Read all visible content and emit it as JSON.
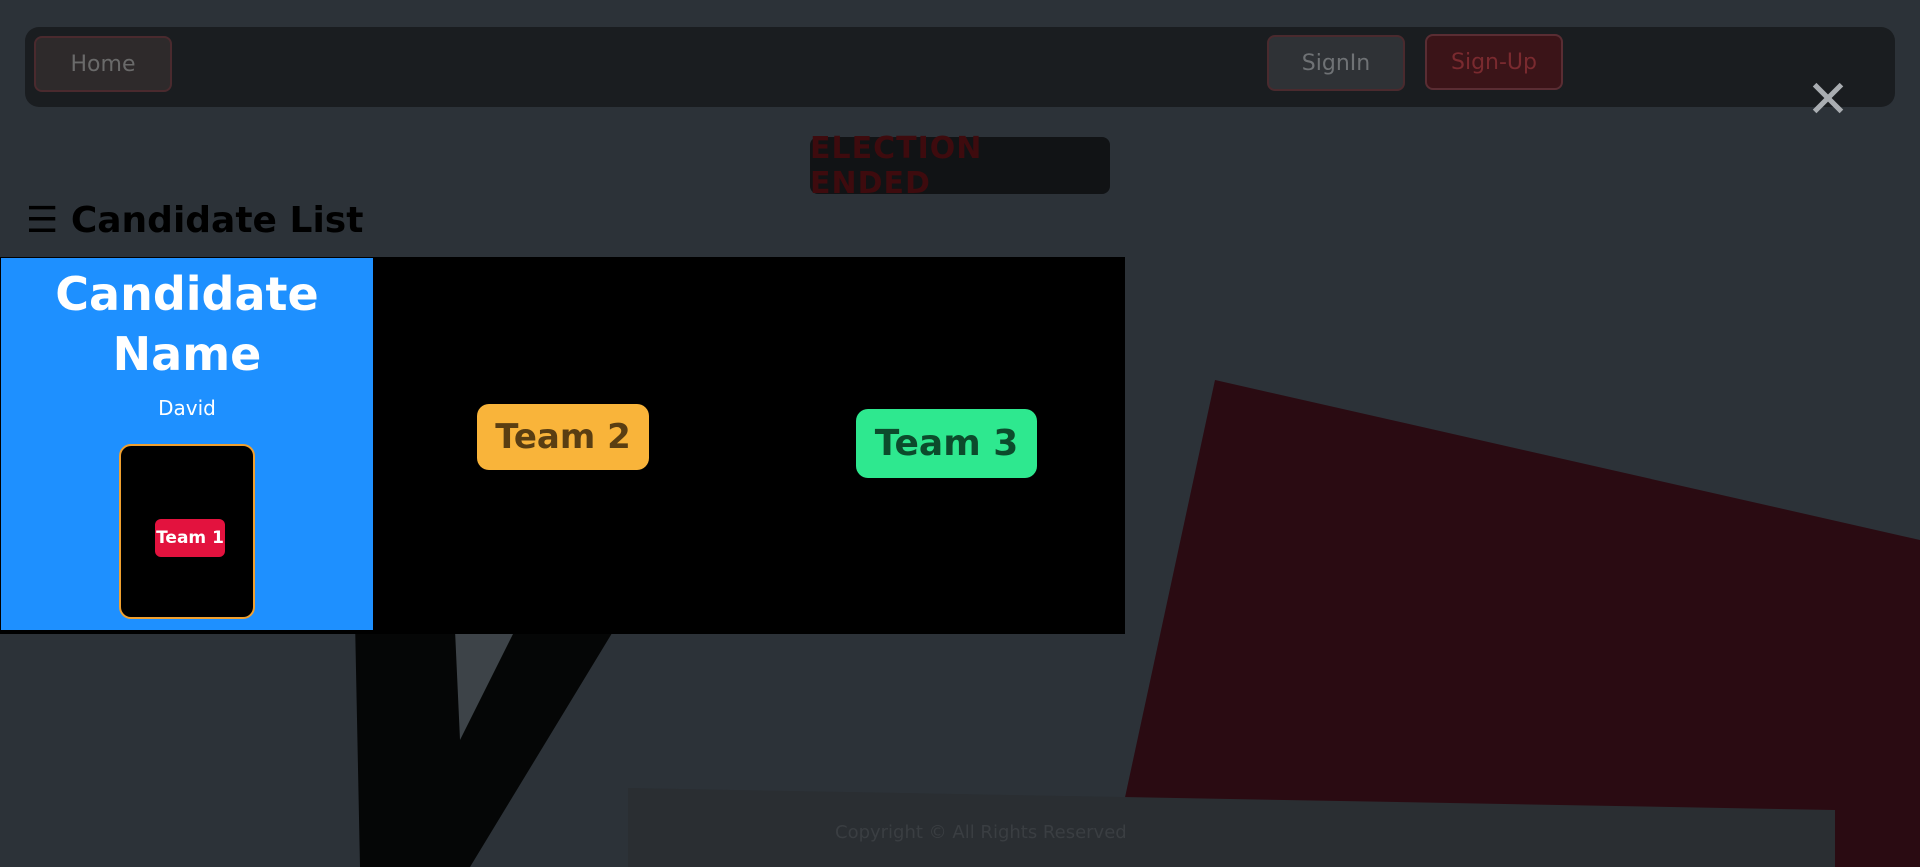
{
  "nav": {
    "home_label": "Home",
    "signin_label": "SignIn",
    "signup_label": "Sign-Up"
  },
  "close_glyph": "✕",
  "brand": "ELECTION ENDED",
  "candidate_list": {
    "icon_glyph": "☰",
    "heading": "Candidate List"
  },
  "card": {
    "title": "Candidate Name",
    "name": "David",
    "slot_team": "Team 1"
  },
  "teams": [
    {
      "label": "Team 2",
      "color": "#f9b43a"
    },
    {
      "label": "Team 3",
      "color": "#2ee88f"
    }
  ],
  "footer": {
    "copyright": "Copyright © All Rights Reserved"
  },
  "colors": {
    "card_bg": "#1e90ff",
    "team1": "#e3123e",
    "slot_border": "#f0a030"
  }
}
